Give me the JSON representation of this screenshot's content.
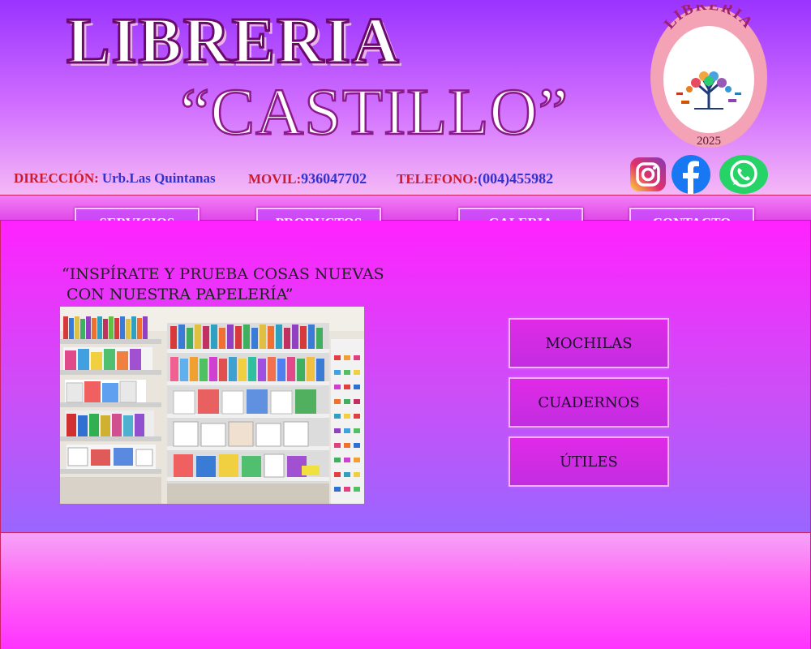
{
  "header": {
    "title_line1": "LIBRERIA",
    "title_line2": "“CASTILLO”",
    "logo": {
      "top_text": "LIBRERIA",
      "year": "2025",
      "icon": "book-tree-icon"
    },
    "address": {
      "label": "DIRECCIÓN:",
      "value": "Urb.Las Quintanas"
    },
    "mobile": {
      "label": "MOVIL:",
      "value": "936047702"
    },
    "phone": {
      "label": "TELEFONO:",
      "value": "(004)455982"
    },
    "social": [
      {
        "name": "instagram-icon",
        "color": "#e1306c"
      },
      {
        "name": "facebook-icon",
        "color": "#1877f2"
      },
      {
        "name": "whatsapp-icon",
        "color": "#25d366"
      }
    ]
  },
  "nav": [
    {
      "label": "SERVICIOS"
    },
    {
      "label": "PRODUCTOS"
    },
    {
      "label": "GALERIA"
    },
    {
      "label": "CONTACTO"
    }
  ],
  "main": {
    "quote_line1": "“INSPÍRATE Y PRUEBA COSAS NUEVAS",
    "quote_line2": " CON NUESTRA PAPELERÍA”",
    "categories": [
      {
        "label": "MOCHILAS"
      },
      {
        "label": "CUADERNOS"
      },
      {
        "label": "ÚTILES"
      }
    ]
  },
  "colors": {
    "accent": "#cc1a2e",
    "value_text": "#3333cc",
    "nav_button": "#c040f2",
    "main_bg": "#ff22ff"
  }
}
